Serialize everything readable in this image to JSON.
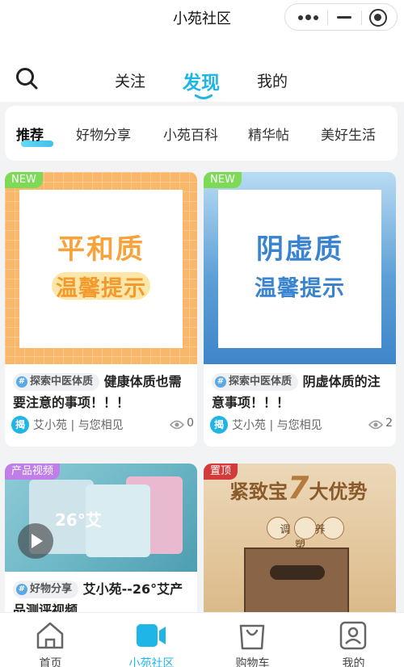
{
  "topbar": {
    "title": "小苑社区"
  },
  "nav": {
    "tabs": [
      "关注",
      "发现",
      "我的"
    ],
    "active": "发现"
  },
  "categories": [
    "推荐",
    "好物分享",
    "小苑百科",
    "精华帖",
    "美好生活"
  ],
  "posts": [
    {
      "badge": "NEW",
      "cover_line1": "平和质",
      "cover_line2": "温馨提示",
      "topic": "探索中医体质",
      "title": "健康体质也需要注意的事项！！！",
      "author": "艾小苑 | 与您相见",
      "views": "0"
    },
    {
      "badge": "NEW",
      "cover_line1": "阴虚质",
      "cover_line2": "温馨提示",
      "topic": "探索中医体质",
      "title": "阴虚体质的注意事项！！！",
      "author": "艾小苑 | 与您相见",
      "views": "2"
    },
    {
      "badge": "产品视频",
      "cover_text": "26°艾",
      "topic": "好物分享",
      "title": "艾小苑--26°艾产品测评视频"
    },
    {
      "badge": "置顶",
      "cover_line1": "紧致宝",
      "cover_num": "7",
      "cover_line2": "大优势",
      "box_text": "调 养 塑"
    }
  ],
  "avatar_text": "揭",
  "tabbar": [
    "首页",
    "小苑社区",
    "购物车",
    "我的"
  ],
  "colors": {
    "accent": "#1fb5e6",
    "new_badge": "#7ed957",
    "video_badge": "#c07ee8",
    "top_badge": "#d43a3a"
  }
}
